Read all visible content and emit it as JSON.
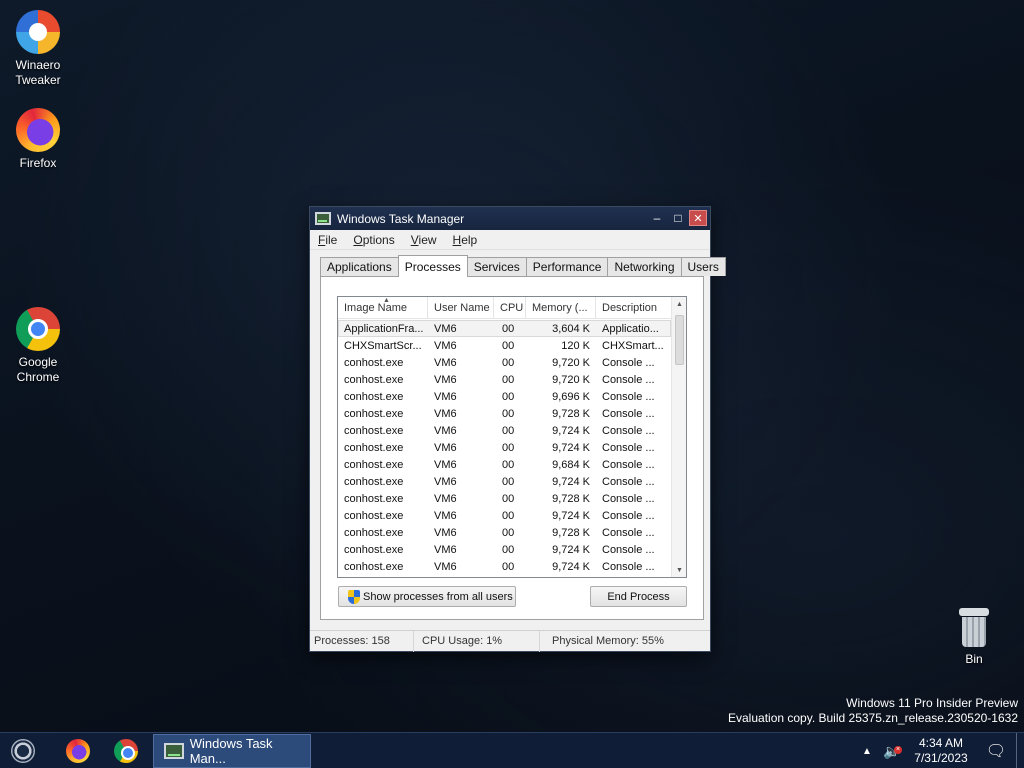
{
  "desktop": {
    "icons": [
      {
        "label_line1": "Winaero",
        "label_line2": "Tweaker"
      },
      {
        "label_line1": "Firefox",
        "label_line2": ""
      },
      {
        "label_line1": "Google",
        "label_line2": "Chrome"
      }
    ],
    "recycle_bin_label": "Bin",
    "watermark": {
      "line1": "Windows 11 Pro Insider Preview",
      "line2": "Evaluation copy. Build 25375.zn_release.230520-1632"
    }
  },
  "taskbar": {
    "task_label": "Windows Task Man...",
    "tray": {
      "chevron": "▲",
      "volume_icon": "🔈",
      "time": "4:34 AM",
      "date": "7/31/2023",
      "notification_icon": "🗨"
    }
  },
  "task_manager": {
    "title": "Windows Task Manager",
    "controls": {
      "minimize": "–",
      "maximize": "□",
      "close": "✕"
    },
    "menu": [
      {
        "underlined": "F",
        "rest": "ile"
      },
      {
        "underlined": "O",
        "rest": "ptions"
      },
      {
        "underlined": "V",
        "rest": "iew"
      },
      {
        "underlined": "H",
        "rest": "elp"
      }
    ],
    "tabs": [
      "Applications",
      "Processes",
      "Services",
      "Performance",
      "Networking",
      "Users"
    ],
    "active_tab": "Processes",
    "columns": [
      "Image Name",
      "User Name",
      "CPU",
      "Memory (...",
      "Description"
    ],
    "rows": [
      [
        "ApplicationFra...",
        "VM6",
        "00",
        "3,604 K",
        "Applicatio..."
      ],
      [
        "CHXSmartScr...",
        "VM6",
        "00",
        "120 K",
        "CHXSmart..."
      ],
      [
        "conhost.exe",
        "VM6",
        "00",
        "9,720 K",
        "Console ..."
      ],
      [
        "conhost.exe",
        "VM6",
        "00",
        "9,720 K",
        "Console ..."
      ],
      [
        "conhost.exe",
        "VM6",
        "00",
        "9,696 K",
        "Console ..."
      ],
      [
        "conhost.exe",
        "VM6",
        "00",
        "9,728 K",
        "Console ..."
      ],
      [
        "conhost.exe",
        "VM6",
        "00",
        "9,724 K",
        "Console ..."
      ],
      [
        "conhost.exe",
        "VM6",
        "00",
        "9,724 K",
        "Console ..."
      ],
      [
        "conhost.exe",
        "VM6",
        "00",
        "9,684 K",
        "Console ..."
      ],
      [
        "conhost.exe",
        "VM6",
        "00",
        "9,724 K",
        "Console ..."
      ],
      [
        "conhost.exe",
        "VM6",
        "00",
        "9,728 K",
        "Console ..."
      ],
      [
        "conhost.exe",
        "VM6",
        "00",
        "9,724 K",
        "Console ..."
      ],
      [
        "conhost.exe",
        "VM6",
        "00",
        "9,728 K",
        "Console ..."
      ],
      [
        "conhost.exe",
        "VM6",
        "00",
        "9,724 K",
        "Console ..."
      ],
      [
        "conhost.exe",
        "VM6",
        "00",
        "9,724 K",
        "Console ..."
      ]
    ],
    "show_all_button": "Show processes from all users",
    "end_process_button": "End Process",
    "status": {
      "processes": "Processes: 158",
      "cpu_usage": "CPU Usage: 1%",
      "physical_memory": "Physical Memory: 55%"
    }
  }
}
